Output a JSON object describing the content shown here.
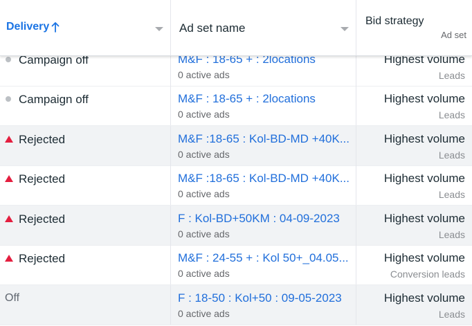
{
  "header": {
    "delivery_label": "Delivery",
    "adset_label": "Ad set name",
    "bid_label": "Bid strategy",
    "bid_sub": "Ad set"
  },
  "rows": [
    {
      "status": "Campaign off",
      "status_type": "dot",
      "name": "M&F : 18-65 + : 2locations",
      "sub": "0 active ads",
      "bid": "Highest volume",
      "bid_sub": "Leads"
    },
    {
      "status": "Campaign off",
      "status_type": "dot",
      "name": "M&F : 18-65 + : 2locations",
      "sub": "0 active ads",
      "bid": "Highest volume",
      "bid_sub": "Leads"
    },
    {
      "status": "Rejected",
      "status_type": "warning",
      "name": "M&F :18-65 : Kol-BD-MD +40K...",
      "sub": "0 active ads",
      "bid": "Highest volume",
      "bid_sub": "Leads"
    },
    {
      "status": "Rejected",
      "status_type": "warning",
      "name": "M&F :18-65 : Kol-BD-MD +40K...",
      "sub": "0 active ads",
      "bid": "Highest volume",
      "bid_sub": "Leads"
    },
    {
      "status": "Rejected",
      "status_type": "warning",
      "name": "F : Kol-BD+50KM : 04-09-2023",
      "sub": "0 active ads",
      "bid": "Highest volume",
      "bid_sub": "Leads"
    },
    {
      "status": "Rejected",
      "status_type": "warning",
      "name": "M&F : 24-55 + : Kol 50+_04.05...",
      "sub": "0 active ads",
      "bid": "Highest volume",
      "bid_sub": "Conversion leads"
    },
    {
      "status": "Off",
      "status_type": "plain",
      "name": "F : 18-50 : Kol+50 : 09-05-2023",
      "sub": "0 active ads",
      "bid": "Highest volume",
      "bid_sub": "Leads"
    }
  ],
  "colors": {
    "link": "#216fdb",
    "accent": "#1b74e4",
    "rejected": "#e41e3f",
    "off_dot": "#bcc0c4"
  },
  "icons": {
    "sort": "arrow-up-icon",
    "column_menu": "chevron-down-icon",
    "rejected": "warning-triangle-icon",
    "off": "status-dot-icon"
  }
}
